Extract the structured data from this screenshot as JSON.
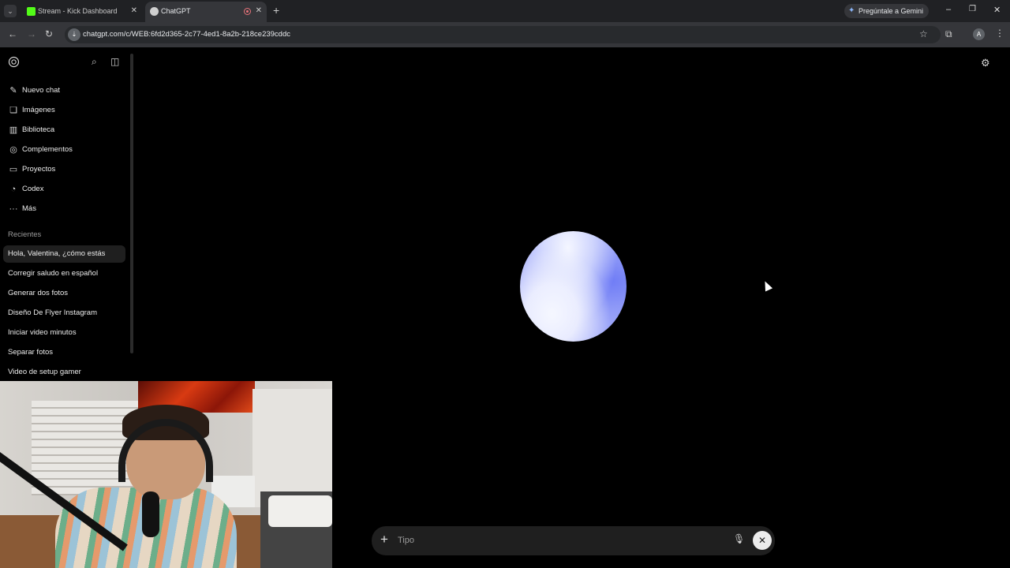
{
  "browser": {
    "tabs": [
      {
        "title": "Stream - Kick Dashboard",
        "favicon_color": "#53fc18"
      },
      {
        "title": "ChatGPT",
        "favicon_color": "#cfcfcf"
      }
    ],
    "new_tab": "+",
    "gemini_label": "Pregúntale a Gemini",
    "url": "chatgpt.com/c/WEB:6fd2d365-2c77-4ed1-8a2b-218ce239cddc",
    "profile_initial": "A",
    "window_controls": {
      "minimize": "–",
      "restore": "❐",
      "close": "✕"
    }
  },
  "sidebar": {
    "menu": [
      {
        "icon": "edit-icon",
        "glyph": "✎",
        "label": "Nuevo chat"
      },
      {
        "icon": "images-icon",
        "glyph": "❏",
        "label": "Imágenes"
      },
      {
        "icon": "library-icon",
        "glyph": "▥",
        "label": "Biblioteca"
      },
      {
        "icon": "plugins-icon",
        "glyph": "◎",
        "label": "Complementos"
      },
      {
        "icon": "folder-icon",
        "glyph": "▭",
        "label": "Proyectos"
      },
      {
        "icon": "codex-icon",
        "glyph": "◔",
        "label": "Codex"
      },
      {
        "icon": "more-icon",
        "glyph": "···",
        "label": "Más"
      }
    ],
    "recents_label": "Recientes",
    "recents": [
      "Hola, Valentina, ¿cómo estás",
      "Corregir saludo en español",
      "Generar dos fotos",
      "Diseño De Flyer Instagram",
      "Iniciar video minutos",
      "Separar fotos",
      "Video de setup gamer"
    ]
  },
  "composer": {
    "placeholder": "Tipo",
    "plus": "+",
    "end_glyph": "✕"
  },
  "colors": {
    "background": "#000000",
    "orb_accent": "#6f7cf6"
  }
}
